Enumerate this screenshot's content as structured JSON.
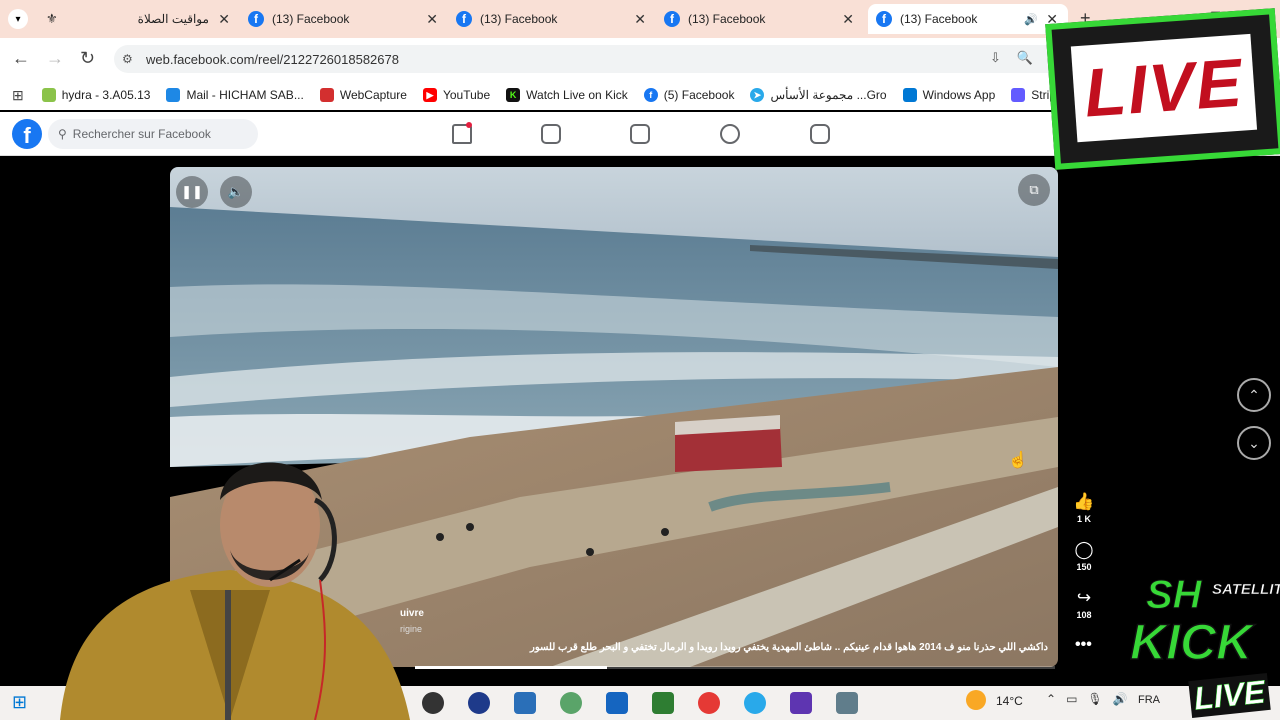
{
  "browser": {
    "tabs": [
      {
        "title": "مواقيت الصلاة",
        "active": false
      },
      {
        "title": "(13) Facebook",
        "active": false
      },
      {
        "title": "(13) Facebook",
        "active": false
      },
      {
        "title": "(13) Facebook",
        "active": false
      },
      {
        "title": "(13) Facebook",
        "active": true
      }
    ],
    "new_tab": "+",
    "url": "web.facebook.com/reel/2122726018582678"
  },
  "bookmarks": [
    {
      "label": "hydra - 3.A05.13",
      "color": "#8bc34a"
    },
    {
      "label": "Mail - HICHAM SAB...",
      "color": "#1e88e5"
    },
    {
      "label": "WebCapture",
      "color": "#d32f2f"
    },
    {
      "label": "YouTube",
      "color": "#ff0000"
    },
    {
      "label": "Watch Live on Kick",
      "color": "#53fc18"
    },
    {
      "label": "(5) Facebook",
      "color": "#1877f2"
    },
    {
      "label": "مجموعة الأسأس ...Gro",
      "color": "#29a9ea"
    },
    {
      "label": "Windows App",
      "color": "#0078d4"
    },
    {
      "label": "Stripe Express",
      "color": "#635bff"
    }
  ],
  "facebook": {
    "search_placeholder": "Rechercher sur Facebook"
  },
  "reel": {
    "caption": "داكشي اللي حذرنا منو ف 2014 هاهوا قدام عينيكم .. شاطئ المهدية يختفي رويدا رويدا و الرمال تختفي و البحر طلع قرب للسور",
    "follow_label": "uivre",
    "origin_label": "rigine",
    "likes": "1 K",
    "comments": "150",
    "shares": "108",
    "progress": 0.3
  },
  "taskbar": {
    "temperature": "14°C",
    "language": "FRA"
  },
  "overlay": {
    "live_text": "LIVE",
    "kick_brand": "KICK",
    "kick_sub": "SATELLITE",
    "kick_live": "LIVE",
    "sh_tag": "SH"
  },
  "colors": {
    "facebook_blue": "#1877f2",
    "tabstrip": "#f9e0d6",
    "kick_green": "#37d837",
    "live_red": "#c20f1f"
  }
}
